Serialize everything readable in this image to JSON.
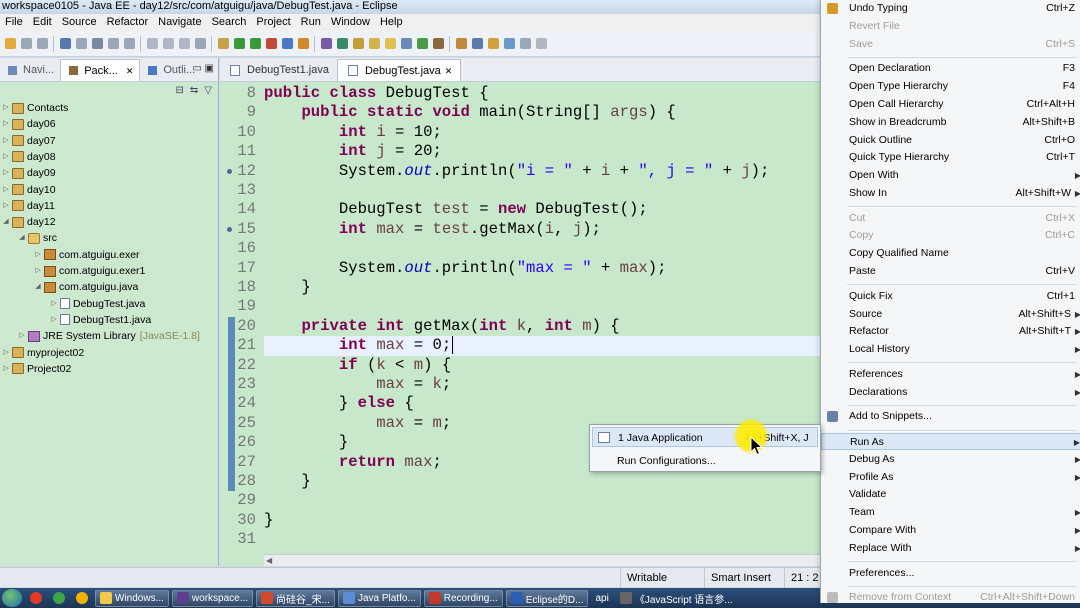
{
  "window": {
    "title": "workspace0105 - Java EE - day12/src/com/atguigu/java/DebugTest.java - Eclipse"
  },
  "menubar": [
    "File",
    "Edit",
    "Source",
    "Refactor",
    "Navigate",
    "Search",
    "Project",
    "Run",
    "Window",
    "Help"
  ],
  "view_tabs": [
    {
      "label": "Navi...",
      "active": false
    },
    {
      "label": "Pack...",
      "active": true
    },
    {
      "label": "Outli...",
      "active": false
    }
  ],
  "tree": [
    {
      "label": "Contacts",
      "depth": 0,
      "kind": "project",
      "twisty": "▷"
    },
    {
      "label": "day06",
      "depth": 0,
      "kind": "project",
      "twisty": "▷"
    },
    {
      "label": "day07",
      "depth": 0,
      "kind": "project",
      "twisty": "▷"
    },
    {
      "label": "day08",
      "depth": 0,
      "kind": "project",
      "twisty": "▷"
    },
    {
      "label": "day09",
      "depth": 0,
      "kind": "project",
      "twisty": "▷"
    },
    {
      "label": "day10",
      "depth": 0,
      "kind": "project",
      "twisty": "▷"
    },
    {
      "label": "day11",
      "depth": 0,
      "kind": "project",
      "twisty": "▷"
    },
    {
      "label": "day12",
      "depth": 0,
      "kind": "project",
      "twisty": "◢"
    },
    {
      "label": "src",
      "depth": 1,
      "kind": "src",
      "twisty": "◢"
    },
    {
      "label": "com.atguigu.exer",
      "depth": 2,
      "kind": "package",
      "twisty": "▷"
    },
    {
      "label": "com.atguigu.exer1",
      "depth": 2,
      "kind": "package",
      "twisty": "▷"
    },
    {
      "label": "com.atguigu.java",
      "depth": 2,
      "kind": "package",
      "twisty": "◢"
    },
    {
      "label": "DebugTest.java",
      "depth": 3,
      "kind": "java",
      "twisty": "▷"
    },
    {
      "label": "DebugTest1.java",
      "depth": 3,
      "kind": "java",
      "twisty": "▷"
    },
    {
      "label": "JRE System Library",
      "suffix": "[JavaSE-1.8]",
      "depth": 1,
      "kind": "jre",
      "twisty": "▷"
    },
    {
      "label": "myproject02",
      "depth": 0,
      "kind": "project",
      "twisty": "▷"
    },
    {
      "label": "Project02",
      "depth": 0,
      "kind": "project",
      "twisty": "▷"
    }
  ],
  "editor_tabs": [
    {
      "label": "DebugTest1.java",
      "active": false
    },
    {
      "label": "DebugTest.java",
      "active": true
    }
  ],
  "code_lines": [
    {
      "n": "8",
      "html": "<span class=\"kw\">public class</span> DebugTest {"
    },
    {
      "n": "9",
      "html": "    <span class=\"kw\">public static void</span> main(String[] <span class=\"vr\">args</span>) {"
    },
    {
      "n": "10",
      "html": "        <span class=\"kw\">int</span> <span class=\"vr\">i</span> = 10;"
    },
    {
      "n": "11",
      "html": "        <span class=\"kw\">int</span> <span class=\"vr\">j</span> = 20;"
    },
    {
      "n": "12",
      "html": "        System.<span class=\"fd\">out</span>.println(<span class=\"st\">\"i = \"</span> + <span class=\"vr\">i</span> + <span class=\"st\">\", j = \"</span> + <span class=\"vr\">j</span>);",
      "marker": true
    },
    {
      "n": "13",
      "html": ""
    },
    {
      "n": "14",
      "html": "        DebugTest <span class=\"vr\">test</span> = <span class=\"kw\">new</span> DebugTest();"
    },
    {
      "n": "15",
      "html": "        <span class=\"kw\">int</span> <span class=\"vr\">max</span> = <span class=\"vr\">test</span>.getMax(<span class=\"vr\">i</span>, <span class=\"vr\">j</span>);",
      "marker": true
    },
    {
      "n": "16",
      "html": ""
    },
    {
      "n": "17",
      "html": "        System.<span class=\"fd\">out</span>.println(<span class=\"st\">\"max = \"</span> + <span class=\"vr\">max</span>);"
    },
    {
      "n": "18",
      "html": "    }"
    },
    {
      "n": "19",
      "html": ""
    },
    {
      "n": "20",
      "html": "    <span class=\"kw\">private int</span> getMax(<span class=\"kw\">int</span> <span class=\"vr\">k</span>, <span class=\"kw\">int</span> <span class=\"vr\">m</span>) {"
    },
    {
      "n": "21",
      "html": "        <span class=\"kw\">int</span> <span class=\"vr\">max</span> = 0;<span class=\"cursor\"></span>",
      "current": true
    },
    {
      "n": "22",
      "html": "        <span class=\"kw\">if</span> (<span class=\"vr\">k</span> &lt; <span class=\"vr\">m</span>) {"
    },
    {
      "n": "23",
      "html": "            <span class=\"vr\">max</span> = <span class=\"vr\">k</span>;"
    },
    {
      "n": "24",
      "html": "        } <span class=\"kw\">else</span> {"
    },
    {
      "n": "25",
      "html": "            <span class=\"vr\">max</span> = <span class=\"vr\">m</span>;"
    },
    {
      "n": "26",
      "html": "        }"
    },
    {
      "n": "27",
      "html": "        <span class=\"kw\">return</span> <span class=\"vr\">max</span>;"
    },
    {
      "n": "28",
      "html": "    }"
    },
    {
      "n": "29",
      "html": ""
    },
    {
      "n": "30",
      "html": "}"
    },
    {
      "n": "31",
      "html": ""
    }
  ],
  "statusbar": {
    "writable": "Writable",
    "insert_mode": "Smart Insert",
    "position": "21 : 2"
  },
  "taskbar": [
    {
      "label": "",
      "color": "#e23a2a"
    },
    {
      "label": "",
      "color": "#3fa34d"
    },
    {
      "label": "",
      "color": "#f0b400"
    },
    {
      "label": "Windows...",
      "color": "#f2c94c",
      "button": true
    },
    {
      "label": "workspace...",
      "color": "#5b3f8e",
      "button": true
    },
    {
      "label": "尚硅谷_宋...",
      "color": "#d14a2b",
      "button": true
    },
    {
      "label": "Java Platfo...",
      "color": "#5b8ad6",
      "button": true
    },
    {
      "label": "Recording...",
      "color": "#c0392b",
      "button": true
    },
    {
      "label": "Eclipse的D...",
      "color": "#2b5fb3",
      "button": true
    },
    {
      "label": "api",
      "color": "",
      "button": false
    },
    {
      "label": "《JavaScript 语言参...",
      "color": "#666",
      "button": false
    }
  ],
  "context_menu": [
    {
      "type": "item",
      "label": "Undo Typing",
      "shortcut": "Ctrl+Z",
      "icon": "undo-icon",
      "icon_color": "#d59a2a"
    },
    {
      "type": "item",
      "label": "Revert File",
      "disabled": true
    },
    {
      "type": "item",
      "label": "Save",
      "shortcut": "Ctrl+S",
      "disabled": true
    },
    {
      "type": "sep"
    },
    {
      "type": "item",
      "label": "Open Declaration",
      "shortcut": "F3"
    },
    {
      "type": "item",
      "label": "Open Type Hierarchy",
      "shortcut": "F4"
    },
    {
      "type": "item",
      "label": "Open Call Hierarchy",
      "shortcut": "Ctrl+Alt+H"
    },
    {
      "type": "item",
      "label": "Show in Breadcrumb",
      "shortcut": "Alt+Shift+B"
    },
    {
      "type": "item",
      "label": "Quick Outline",
      "shortcut": "Ctrl+O"
    },
    {
      "type": "item",
      "label": "Quick Type Hierarchy",
      "shortcut": "Ctrl+T"
    },
    {
      "type": "item",
      "label": "Open With",
      "submenu": true
    },
    {
      "type": "item",
      "label": "Show In",
      "shortcut": "Alt+Shift+W",
      "submenu": true
    },
    {
      "type": "sep"
    },
    {
      "type": "item",
      "label": "Cut",
      "shortcut": "Ctrl+X",
      "disabled": true
    },
    {
      "type": "item",
      "label": "Copy",
      "shortcut": "Ctrl+C",
      "disabled": true
    },
    {
      "type": "item",
      "label": "Copy Qualified Name"
    },
    {
      "type": "item",
      "label": "Paste",
      "shortcut": "Ctrl+V"
    },
    {
      "type": "sep"
    },
    {
      "type": "item",
      "label": "Quick Fix",
      "shortcut": "Ctrl+1"
    },
    {
      "type": "item",
      "label": "Source",
      "shortcut": "Alt+Shift+S",
      "submenu": true
    },
    {
      "type": "item",
      "label": "Refactor",
      "shortcut": "Alt+Shift+T",
      "submenu": true
    },
    {
      "type": "item",
      "label": "Local History",
      "submenu": true
    },
    {
      "type": "sep"
    },
    {
      "type": "item",
      "label": "References",
      "submenu": true
    },
    {
      "type": "item",
      "label": "Declarations",
      "submenu": true
    },
    {
      "type": "sep"
    },
    {
      "type": "item",
      "label": "Add to Snippets...",
      "icon": "snippet-icon",
      "icon_color": "#6b7fa8"
    },
    {
      "type": "sep"
    },
    {
      "type": "item",
      "label": "Run As",
      "submenu": true,
      "selected": true
    },
    {
      "type": "item",
      "label": "Debug As",
      "submenu": true
    },
    {
      "type": "item",
      "label": "Profile As",
      "submenu": true
    },
    {
      "type": "item",
      "label": "Validate"
    },
    {
      "type": "item",
      "label": "Team",
      "submenu": true
    },
    {
      "type": "item",
      "label": "Compare With",
      "submenu": true
    },
    {
      "type": "item",
      "label": "Replace With",
      "submenu": true
    },
    {
      "type": "sep"
    },
    {
      "type": "item",
      "label": "Preferences..."
    },
    {
      "type": "sep"
    },
    {
      "type": "item",
      "label": "Remove from Context",
      "shortcut": "Ctrl+Alt+Shift+Down",
      "disabled": true,
      "icon": "remove-icon",
      "icon_color": "#bbbbbb"
    }
  ],
  "submenu": [
    {
      "label": "1 Java Application",
      "shortcut": "Alt+Shift+X, J",
      "selected": true,
      "icon": "java-app-icon"
    },
    {
      "label": "Run Configurations..."
    }
  ],
  "colors": {
    "editor_bg": "#c7e8cb",
    "keyword": "#7f0055",
    "string": "#2a00ff",
    "field": "#0000c0",
    "selection": "#dce8f6",
    "highlight": "#ffeb00"
  }
}
